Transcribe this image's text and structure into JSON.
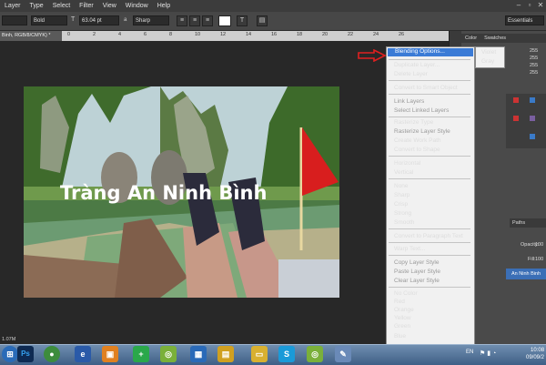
{
  "menubar": {
    "items": [
      "Layer",
      "Type",
      "Select",
      "Filter",
      "View",
      "Window",
      "Help"
    ]
  },
  "options": {
    "font_style": "Bold",
    "font_size": "63.04 pt",
    "antialias_prefix": "a",
    "antialias": "Sharp",
    "workspace": "Essentials"
  },
  "document": {
    "tab_title": "Binh, RGB/8/CMYK) *",
    "ruler_ticks": [
      "0",
      "2",
      "4",
      "6",
      "8",
      "10",
      "12",
      "14",
      "16",
      "18",
      "20",
      "22",
      "24",
      "26"
    ]
  },
  "photo": {
    "overlay_text": "Tràng An Ninh Bình"
  },
  "panels": {
    "tabs": [
      "Color",
      "Swatches"
    ],
    "values": [
      "255",
      "255",
      "255",
      "255"
    ],
    "paths_label": "Paths",
    "opacity_label": "Opacity:",
    "opacity_value": "100",
    "fill_label": "Fill:",
    "fill_value": "100",
    "layer_name": "An Ninh Binh"
  },
  "context_menu": {
    "items": [
      {
        "label": "Blending Options...",
        "disabled": false
      },
      {
        "label": "Duplicate Layer...",
        "disabled": false
      },
      {
        "label": "Delete Layer",
        "disabled": false
      },
      {
        "label": "Convert to Smart Object",
        "disabled": false
      },
      {
        "label": "Link Layers",
        "disabled": true
      },
      {
        "label": "Select Linked Layers",
        "disabled": true
      },
      {
        "label": "Rasterize Type",
        "disabled": false
      },
      {
        "label": "Rasterize Layer Style",
        "disabled": true
      },
      {
        "label": "Create Work Path",
        "disabled": false
      },
      {
        "label": "Convert to Shape",
        "disabled": false
      },
      {
        "label": "Horizontal",
        "disabled": false
      },
      {
        "label": "Vertical",
        "disabled": false
      },
      {
        "label": "None",
        "disabled": false
      },
      {
        "label": "Sharp",
        "disabled": false
      },
      {
        "label": "Crisp",
        "disabled": false
      },
      {
        "label": "Strong",
        "disabled": false
      },
      {
        "label": "Smooth",
        "disabled": false
      },
      {
        "label": "Convert to Paragraph Text",
        "disabled": false
      },
      {
        "label": "Warp Text...",
        "disabled": false
      },
      {
        "label": "Copy Layer Style",
        "disabled": true
      },
      {
        "label": "Paste Layer Style",
        "disabled": true
      },
      {
        "label": "Clear Layer Style",
        "disabled": true
      },
      {
        "label": "No Color",
        "disabled": false
      },
      {
        "label": "Red",
        "disabled": false
      },
      {
        "label": "Orange",
        "disabled": false
      },
      {
        "label": "Yellow",
        "disabled": false
      },
      {
        "label": "Green",
        "disabled": false
      },
      {
        "label": "Blue",
        "disabled": false
      }
    ],
    "submenu": [
      "Violet",
      "Gray"
    ]
  },
  "status": {
    "doc_info": "1.07M"
  },
  "taskbar": {
    "language": "EN",
    "time": "10:08",
    "date": "09/09/2"
  },
  "colors": {
    "highlight": "#3b7bd6",
    "arrow": "#e02020",
    "flag": "#d81e1e"
  }
}
